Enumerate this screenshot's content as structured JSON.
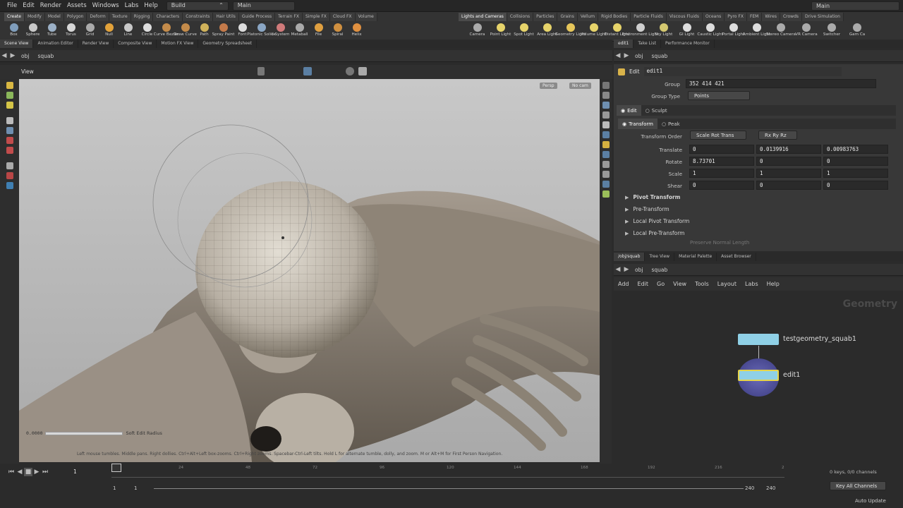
{
  "menubar": {
    "items": [
      "File",
      "Edit",
      "Render",
      "Assets",
      "Windows",
      "Labs",
      "Help"
    ],
    "desktop": "Build",
    "session": "Main",
    "right_session": "Main"
  },
  "shelf": {
    "left_tabs": [
      "Create",
      "Modify",
      "Model",
      "Polygon",
      "Deform",
      "Texture",
      "Rigging",
      "Characters",
      "Constraints",
      "Hair Utils",
      "Guide Process",
      "Terrain FX",
      "Simple FX",
      "Cloud FX",
      "Volume"
    ],
    "left_tools": [
      "Box",
      "Sphere",
      "Tube",
      "Torus",
      "Grid",
      "Null",
      "Line",
      "Circle",
      "Curve Bezier",
      "Draw Curve",
      "Path",
      "Spray Paint",
      "Font",
      "Platonic Solids",
      "L-System",
      "Metaball",
      "File",
      "Spiral",
      "Helix"
    ],
    "right_tabs": [
      "Lights and Cameras",
      "Collisions",
      "Particles",
      "Grains",
      "Vellum",
      "Rigid Bodies",
      "Particle Fluids",
      "Viscous Fluids",
      "Oceans",
      "Pyro FX",
      "FEM",
      "Wires",
      "Crowds",
      "Drive Simulation"
    ],
    "right_tools": [
      "Camera",
      "Point Light",
      "Spot Light",
      "Area Light",
      "Geometry Light",
      "Volume Light",
      "Distant Light",
      "Environment Light",
      "Sky Light",
      "GI Light",
      "Caustic Light",
      "Portal Light",
      "Ambient Light",
      "Stereo Camera",
      "VR Camera",
      "Switcher",
      "Gam Ca"
    ]
  },
  "left_pane": {
    "tabs": [
      "Scene View",
      "Animation Editor",
      "Render View",
      "Composite View",
      "Motion FX View",
      "Geometry Spreadsheet"
    ],
    "path": [
      "obj",
      "squab"
    ],
    "view_label": "View",
    "persp": "Persp",
    "camera": "No cam",
    "soft_radius_value": "0.0000",
    "soft_radius_label": "Soft Edit Radius",
    "status": "Left mouse tumbles. Middle pans. Right dollies. Ctrl+Alt+Left box-zooms. Ctrl+Right zooms. Spacebar-Ctrl-Left tilts. Hold L for alternate tumble, dolly, and zoom.     M or Alt+M for First Person Navigation."
  },
  "params": {
    "tabs": [
      "edit1",
      "Take List",
      "Performance Monitor"
    ],
    "path": [
      "obj",
      "squab"
    ],
    "node_type": "Edit",
    "node_name": "edit1",
    "group_label": "Group",
    "group_value": "352 414 421",
    "group_type_label": "Group Type",
    "group_type_value": "Points",
    "mode_edit": "Edit",
    "mode_sculpt": "Sculpt",
    "sub_transform": "Transform",
    "sub_peak": "Peak",
    "transform_order_label": "Transform Order",
    "transform_order_value": "Scale Rot Trans",
    "rot_order_value": "Rx Ry Rz",
    "translate": {
      "label": "Translate",
      "x": "0",
      "y": "0.0139916",
      "z": "0.00983763"
    },
    "rotate": {
      "label": "Rotate",
      "x": "8.73701",
      "y": "0",
      "z": "0"
    },
    "scale": {
      "label": "Scale",
      "x": "1",
      "y": "1",
      "z": "1"
    },
    "shear": {
      "label": "Shear",
      "x": "0",
      "y": "0",
      "z": "0"
    },
    "folders": [
      "Pivot Transform",
      "Pre-Transform",
      "Local Pivot Transform",
      "Local Pre-Transform"
    ],
    "preserve": "Preserve Normal Length"
  },
  "network": {
    "tabs": [
      "/obj/squab",
      "Tree View",
      "Material Palette",
      "Asset Browser"
    ],
    "path": [
      "obj",
      "squab"
    ],
    "menu": [
      "Add",
      "Edit",
      "Go",
      "View",
      "Tools",
      "Layout",
      "Labs",
      "Help"
    ],
    "context_label": "Geometry",
    "nodes": [
      {
        "name": "testgeometry_squab1",
        "color": "#8fd0e6"
      },
      {
        "name": "edit1",
        "color": "#8fd0e6"
      }
    ]
  },
  "timeline": {
    "ticks": [
      "1",
      "24",
      "48",
      "72",
      "96",
      "120",
      "144",
      "168",
      "192",
      "216",
      "2"
    ],
    "current_frame": "1",
    "start": "1",
    "start2": "1",
    "end": "240",
    "end2": "240",
    "keys_channels": "0 keys, 0/0 channels",
    "key_all": "Key All Channels",
    "auto_update": "Auto Update"
  }
}
